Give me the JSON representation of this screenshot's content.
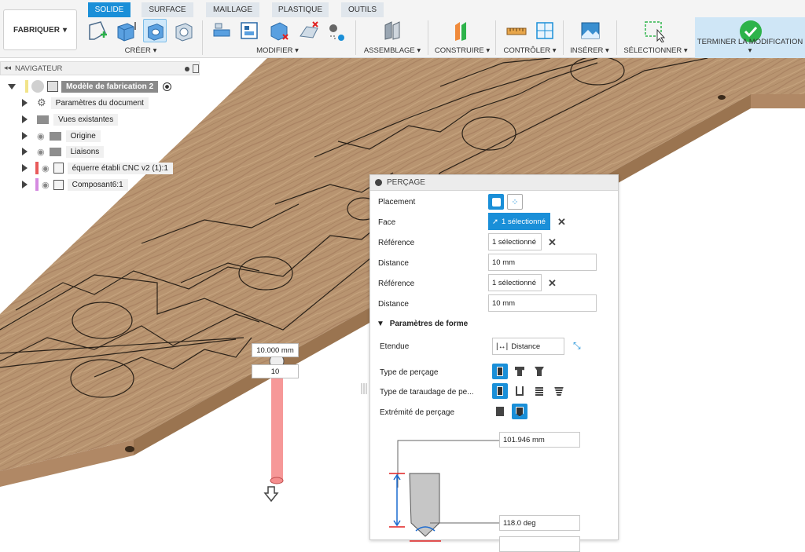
{
  "toolbar": {
    "workspace": "FABRIQUER",
    "tabs": [
      "SOLIDE",
      "SURFACE",
      "MAILLAGE",
      "PLASTIQUE",
      "OUTILS"
    ],
    "groups": {
      "creer": "CRÉER",
      "modifier": "MODIFIER",
      "assemblage": "ASSEMBLAGE",
      "construire": "CONSTRUIRE",
      "controler": "CONTRÔLER",
      "inserer": "INSÉRER",
      "selectionner": "SÉLECTIONNER",
      "terminer": "TERMINER LA MODIFICATION"
    },
    "dropdown_glyph": "▾",
    "accent_color": "#1a8fd8",
    "finish_color": "#2db34a"
  },
  "navigator": {
    "title": "NAVIGATEUR",
    "root": "Modèle de fabrication 2",
    "items": [
      "Paramètres du document",
      "Vues existantes",
      "Origine",
      "Liaisons",
      "équerre établi CNC v2 (1):1",
      "Composant6:1"
    ]
  },
  "dialog": {
    "title": "PERÇAGE",
    "placement_label": "Placement",
    "face_label": "Face",
    "face_value": "1 sélectionné",
    "ref1_label": "Référence",
    "ref1_value": "1 sélectionné",
    "dist1_label": "Distance",
    "dist1_value": "10 mm",
    "ref2_label": "Référence",
    "ref2_value": "1 sélectionné",
    "dist2_label": "Distance",
    "dist2_value": "10 mm",
    "section_label": "Paramètres de forme",
    "etendue_label": "Etendue",
    "etendue_value": "Distance",
    "type_label": "Type de perçage",
    "taraudage_label": "Type de taraudage de pe...",
    "extremite_label": "Extrémité de perçage",
    "depth_value": "101.946 mm",
    "angle_value": "118.0 deg"
  },
  "canvas": {
    "dim_input": "10.000 mm",
    "count_input": "10"
  }
}
